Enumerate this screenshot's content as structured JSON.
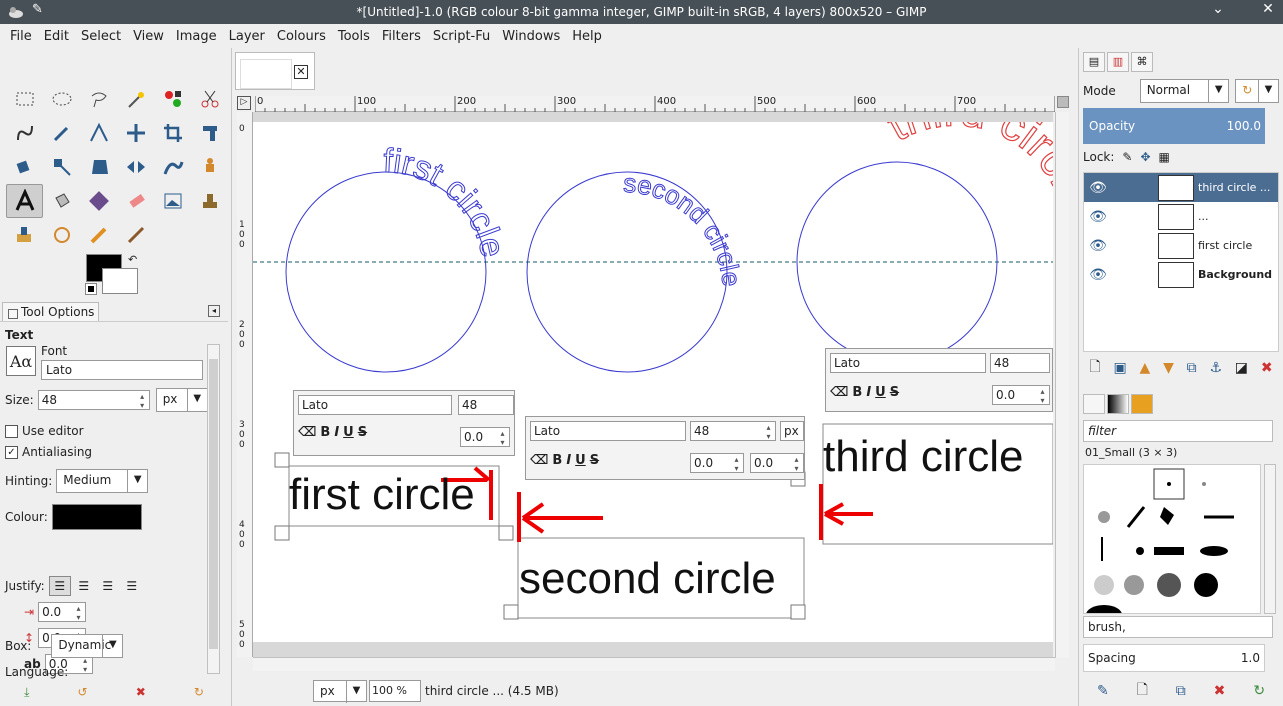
{
  "window": {
    "title": "*[Untitled]-1.0 (RGB colour 8-bit gamma integer, GIMP built-in sRGB, 4 layers) 800x520 – GIMP",
    "minimize": "⌄",
    "close": "✕"
  },
  "menu": [
    "File",
    "Edit",
    "Select",
    "View",
    "Image",
    "Layer",
    "Colours",
    "Tools",
    "Filters",
    "Script-Fu",
    "Windows",
    "Help"
  ],
  "tool_options": {
    "tab_label": "Tool Options",
    "section": "Text",
    "font_label": "Font",
    "font_preview": "Aα",
    "font_value": "Lato",
    "size_label": "Size:",
    "size_value": "48",
    "size_unit": "px",
    "use_editor": "Use editor",
    "antialiasing": "Antialiasing",
    "hinting_label": "Hinting:",
    "hinting_value": "Medium",
    "colour_label": "Colour:",
    "justify_label": "Justify:",
    "indent_value": "0.0",
    "line_spacing_value": "0.0",
    "letter_spacing_value": "0.0",
    "box_label": "Box:",
    "box_value": "Dynamic",
    "language_label": "Language:"
  },
  "canvas": {
    "ruler_marks": [
      "0",
      "100",
      "200",
      "300",
      "400",
      "500",
      "600",
      "700"
    ],
    "circle_texts": {
      "first": "first circle",
      "second": "second circle",
      "third": "third circle"
    },
    "text_boxes": [
      {
        "font": "Lato",
        "size": "48",
        "baseline": "0.0",
        "text": "first circle"
      },
      {
        "font": "Lato",
        "size": "48",
        "unit": "px",
        "baseline": "0.0",
        "kerning": "0.0",
        "text": "second circle"
      },
      {
        "font": "Lato",
        "size": "48",
        "baseline": "0.0",
        "text": "third circle"
      }
    ]
  },
  "statusbar": {
    "unit": "px",
    "zoom": "100 %",
    "message": "third circle ... (4.5 MB)"
  },
  "layers_panel": {
    "mode_label": "Mode",
    "mode_value": "Normal",
    "opacity_label": "Opacity",
    "opacity_value": "100.0",
    "lock_label": "Lock:",
    "layers": [
      {
        "name": "third circle ...",
        "selected": true,
        "bold": false
      },
      {
        "name": "...",
        "selected": false,
        "bold": false
      },
      {
        "name": "first circle",
        "selected": false,
        "bold": false
      },
      {
        "name": "Background",
        "selected": false,
        "bold": true
      }
    ]
  },
  "brushes_panel": {
    "filter_placeholder": "filter",
    "brush_set": "01_Small (3 × 3)",
    "brush_name": "brush,",
    "spacing_label": "Spacing",
    "spacing_value": "1.0"
  }
}
